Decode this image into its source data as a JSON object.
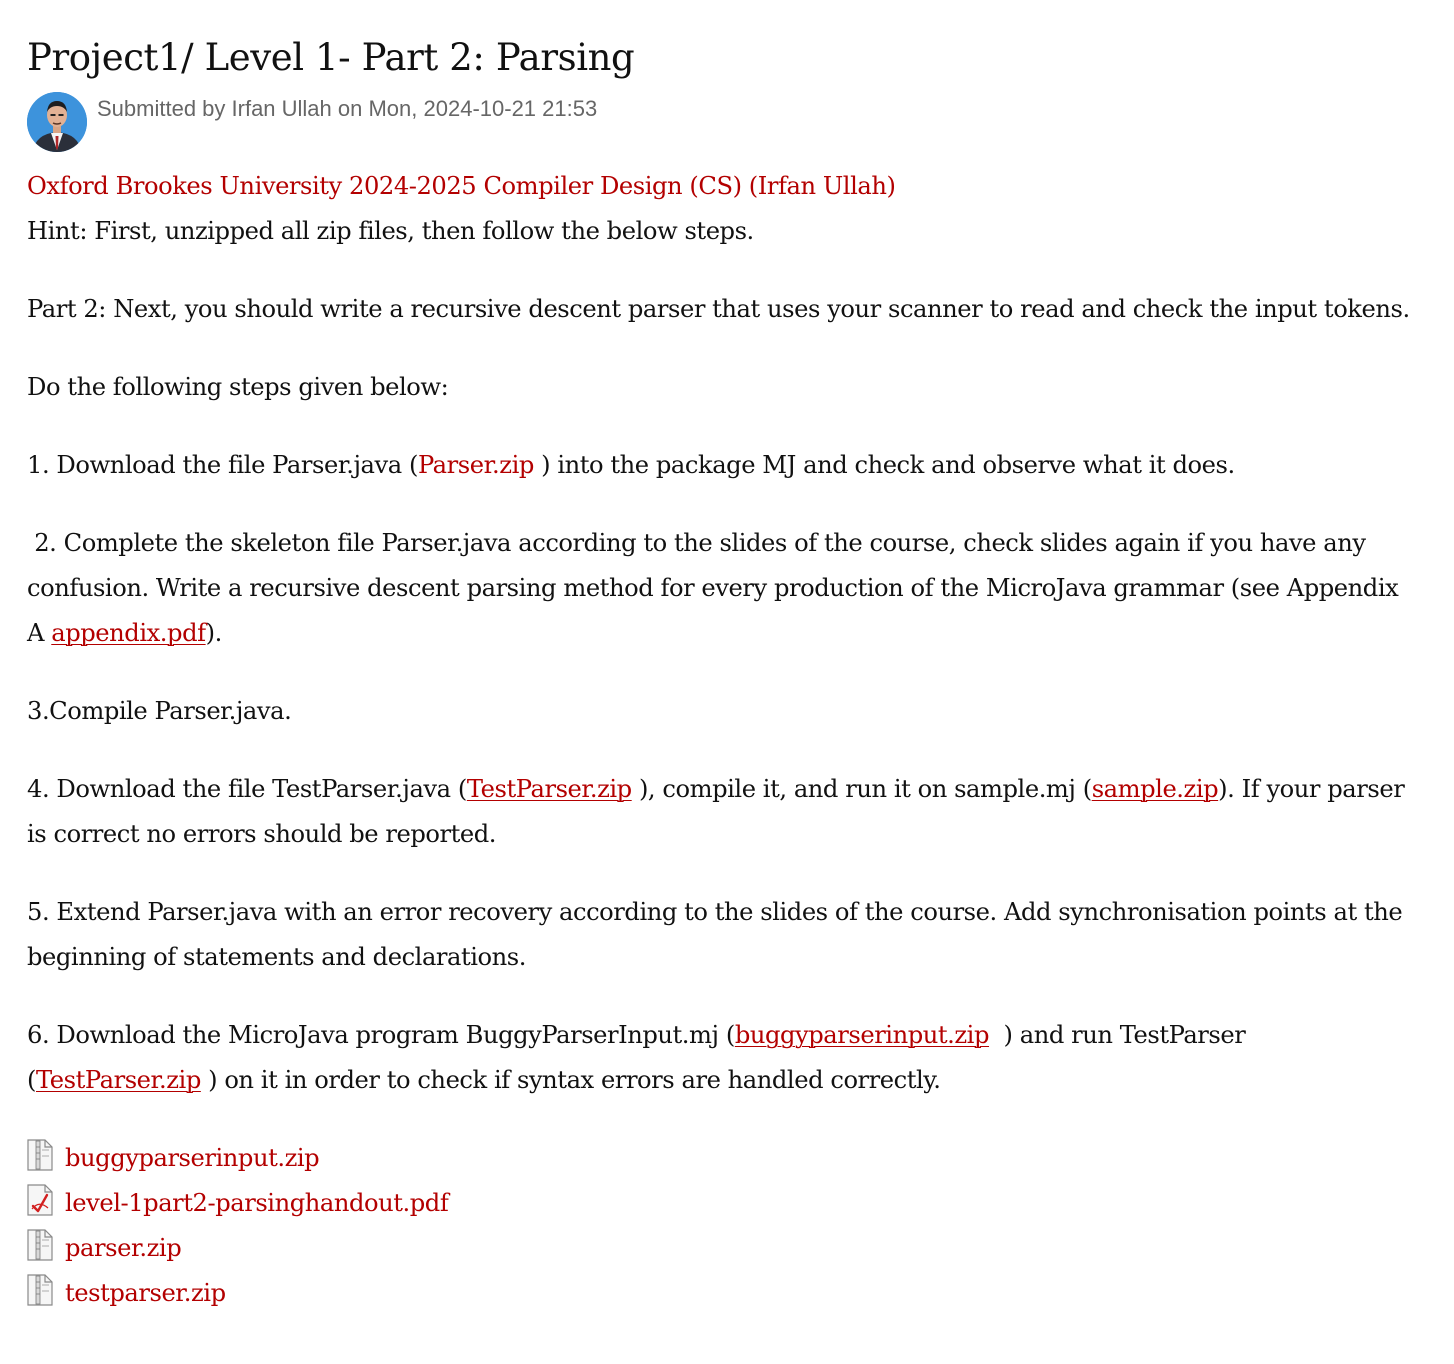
{
  "node": {
    "title": "Project1/ Level 1- Part 2: Parsing",
    "submitted": "Submitted by Irfan Ullah on Mon, 2024-10-21 21:53"
  },
  "content": {
    "course_link": "Oxford Brookes University 2024-2025 Compiler Design (CS) (Irfan Ullah)",
    "hint": "Hint: First, unzipped all zip files, then follow the below steps.",
    "part2": "Part 2: Next, you should write a recursive descent parser that uses your scanner to read and check the input tokens.",
    "intro": "Do the following steps given below:",
    "step1": {
      "before": "1. Download the file Parser.java (",
      "link": "Parser.zip",
      "after": " ) into the package MJ and check and observe what it does."
    },
    "step2": {
      "before": " 2. Complete the skeleton file Parser.java according to the slides of the course, check slides again if you have any confusion. Write a recursive descent parsing method for every production of the MicroJava grammar (see Appendix A ",
      "link": "appendix.pdf",
      "after": ")."
    },
    "step3": "3.Compile Parser.java.",
    "step4": {
      "before": "4. Download the file TestParser.java (",
      "link1": "TestParser.zip",
      "middle": " ), compile it, and run it on sample.mj (",
      "link2": "sample.zip",
      "after": "). If your parser is correct no errors should be reported."
    },
    "step5": "5. Extend Parser.java with an error recovery according to the slides of the course. Add synchronisation points at the beginning of statements and declarations.",
    "step6": {
      "before": "6. Download the MicroJava program BuggyParserInput.mj (",
      "link1": "buggyparserinput.zip",
      "middle": "  ) and run TestParser (",
      "link2": "TestParser.zip",
      "after": " ) on it in order to check if syntax errors are handled correctly."
    }
  },
  "attachments": [
    {
      "name": "buggyparserinput.zip",
      "icon": "zip-file-icon"
    },
    {
      "name": "level-1part2-parsinghandout.pdf",
      "icon": "pdf-file-icon"
    },
    {
      "name": "parser.zip",
      "icon": "zip-file-icon"
    },
    {
      "name": "testparser.zip",
      "icon": "zip-file-icon"
    }
  ],
  "colors": {
    "link": "#b30000",
    "text": "#111111",
    "meta": "#666666"
  }
}
